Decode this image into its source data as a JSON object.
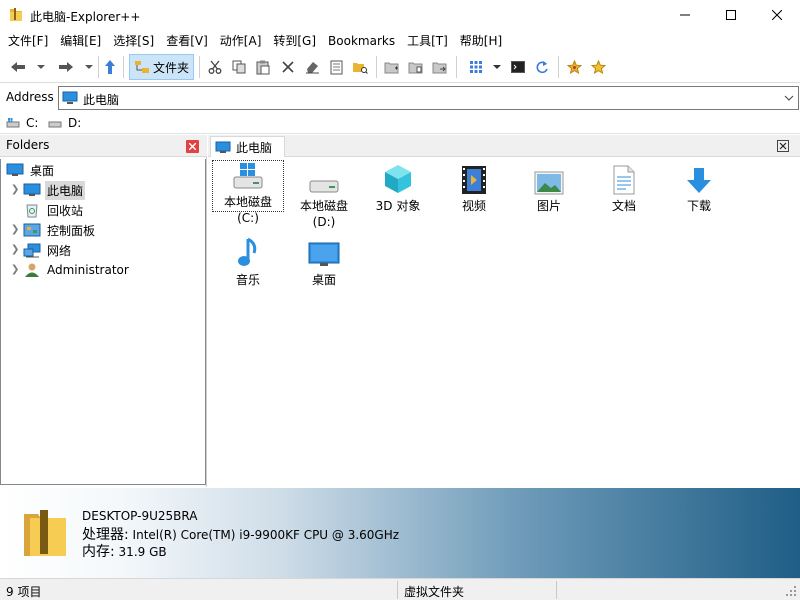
{
  "window": {
    "title": "此电脑-Explorer++"
  },
  "menu": [
    "文件[F]",
    "编辑[E]",
    "选择[S]",
    "查看[V]",
    "动作[A]",
    "转到[G]",
    "Bookmarks",
    "工具[T]",
    "帮助[H]"
  ],
  "toolbar": {
    "folders_label": "文件夹"
  },
  "address": {
    "label": "Address",
    "value": "此电脑"
  },
  "drives": [
    {
      "label": "C:"
    },
    {
      "label": "D:"
    }
  ],
  "folders_pane": {
    "title": "Folders",
    "tree": [
      {
        "label": "桌面",
        "icon": "desktop-icon"
      },
      {
        "label": "此电脑",
        "icon": "computer-icon",
        "selected": true
      },
      {
        "label": "回收站",
        "icon": "recycle-bin-icon"
      },
      {
        "label": "控制面板",
        "icon": "control-panel-icon"
      },
      {
        "label": "网络",
        "icon": "network-icon"
      },
      {
        "label": "Administrator",
        "icon": "user-icon"
      }
    ]
  },
  "tab": {
    "label": "此电脑"
  },
  "items": [
    {
      "label": "本地磁盘 (C:)",
      "icon": "windows-drive-icon"
    },
    {
      "label": "本地磁盘\n(D:)",
      "icon": "drive-icon"
    },
    {
      "label": "3D 对象",
      "icon": "3d-objects-icon"
    },
    {
      "label": "视频",
      "icon": "video-icon"
    },
    {
      "label": "图片",
      "icon": "pictures-icon"
    },
    {
      "label": "文档",
      "icon": "documents-icon"
    },
    {
      "label": "下载",
      "icon": "downloads-icon"
    },
    {
      "label": "音乐",
      "icon": "music-icon"
    },
    {
      "label": "桌面",
      "icon": "desktop-icon"
    }
  ],
  "details": {
    "computer_name": "DESKTOP-9U25BRA",
    "cpu_label": "处理器:",
    "cpu_value": "Intel(R) Core(TM) i9-9900KF CPU @ 3.60GHz",
    "mem_label": "内存:",
    "mem_value": "31.9 GB"
  },
  "status": {
    "count": "9 项目",
    "type": "虚拟文件夹"
  },
  "colors": {
    "accent": "#cce4f7",
    "details_gradient_end": "#1f5e86",
    "close_red": "#e04343"
  }
}
